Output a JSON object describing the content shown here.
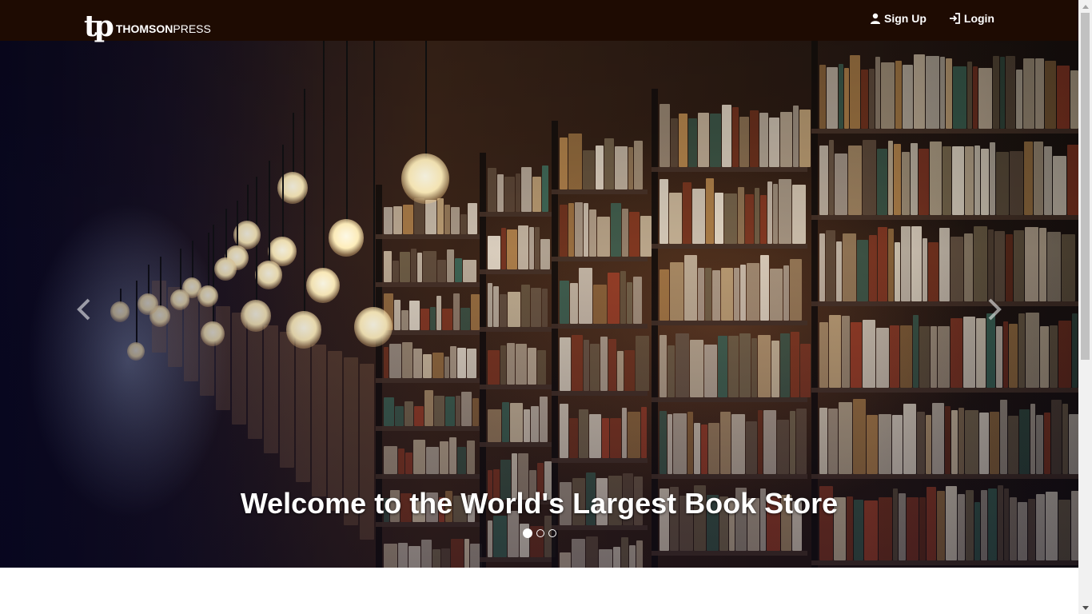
{
  "brand": {
    "logo_mark": "tp",
    "name_bold": "THOMSON",
    "name_light": "PRESS"
  },
  "nav": {
    "signup_label": "Sign Up",
    "login_label": "Login"
  },
  "carousel": {
    "caption": "Welcome to the World's Largest Book Store",
    "slide_count": 3,
    "active_slide": 1,
    "prev_icon": "chevron-left-icon",
    "next_icon": "chevron-right-icon"
  },
  "colors": {
    "navbar_bg": "#1e0b02",
    "text": "#ffffff"
  }
}
